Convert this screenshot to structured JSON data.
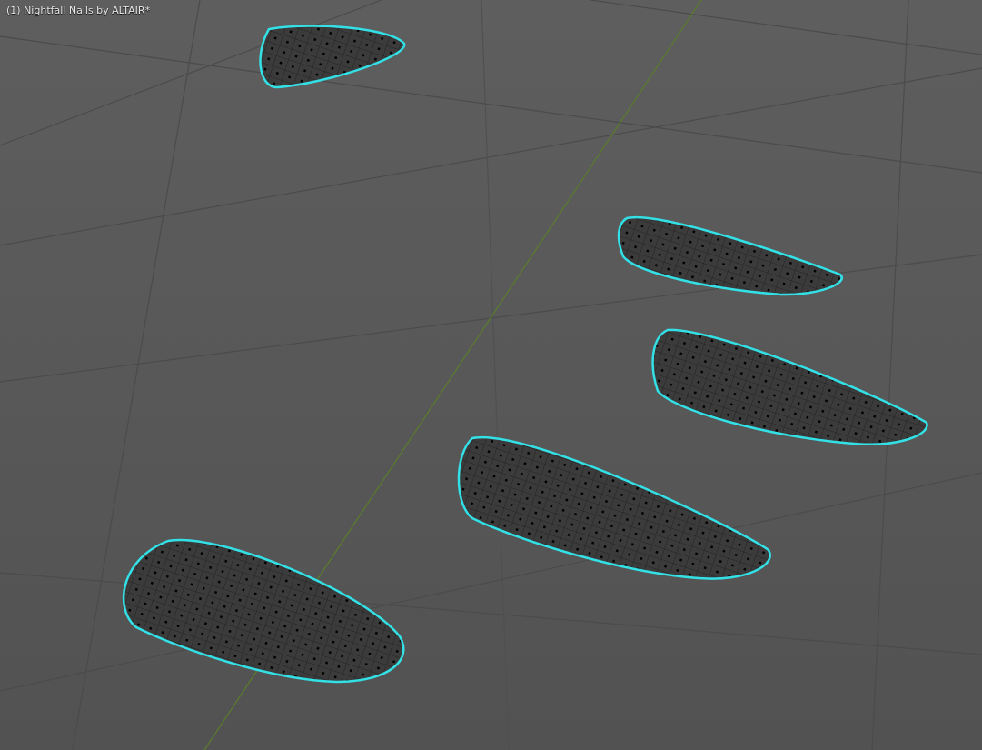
{
  "viewport": {
    "title": "(1) Nightfall Nails by ALTAIR*",
    "colors": {
      "background": "#575757",
      "grid": "#4a4a4a",
      "y_axis": "#5a7a2e",
      "selection_outline": "#33e0e6",
      "mesh_fill": "#3a3a3a",
      "wire": "#1a1a1a"
    },
    "objects": [
      "nail-1",
      "nail-2",
      "nail-3",
      "nail-4",
      "nail-5"
    ]
  }
}
